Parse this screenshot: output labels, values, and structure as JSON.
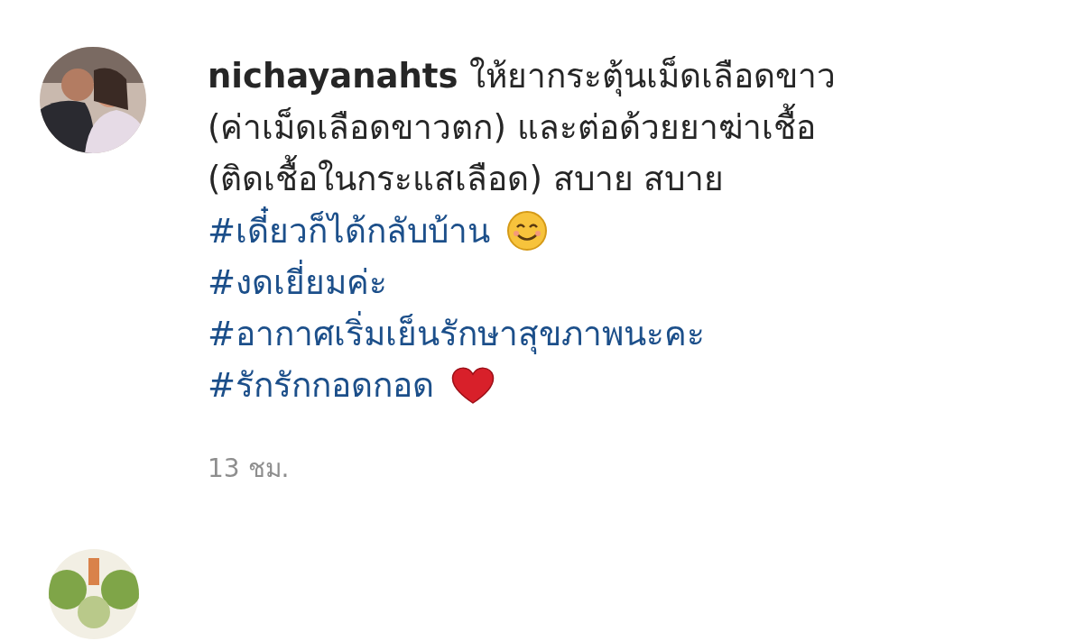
{
  "comment": {
    "username": "nichayanahts",
    "text_lines": [
      "ให้ยากระตุ้นเม็ดเลือดขาว",
      "(ค่าเม็ดเลือดขาวตก) และต่อด้วยยาฆ่าเชื้อ",
      "(ติดเชื้อในกระแสเลือด) สบาย สบาย"
    ],
    "hashtags": [
      {
        "text": "#เดี๋ยวก็ได้กลับบ้าน",
        "kind": "smile"
      },
      {
        "text": "#งดเยี่ยมค่ะ",
        "kind": "plain"
      },
      {
        "text": "#อากาศเริ่มเย็นรักษาสุขภาพนะคะ",
        "kind": "plain"
      },
      {
        "text": "#รักรักกอดกอด",
        "kind": "heart"
      }
    ],
    "time": "13 ชม."
  }
}
